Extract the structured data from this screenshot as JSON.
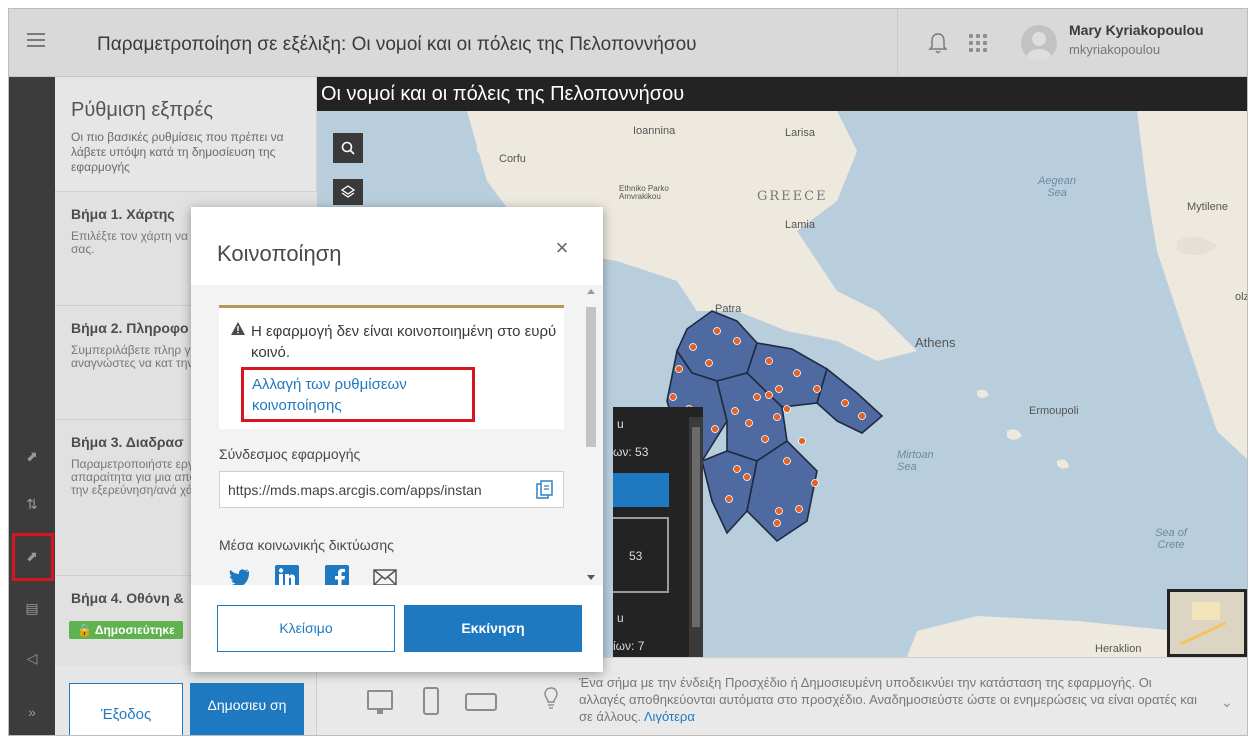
{
  "header": {
    "title": "Παραμετροποίηση σε εξέλιξη: Οι νομοί και οι πόλεις της Πελοποννήσου",
    "user_name": "Mary Kyriakopoulou",
    "user_login": "mkyriakopoulou"
  },
  "settings": {
    "title": "Ρύθμιση εξπρές",
    "description": "Οι πιο βασικές ρυθμίσεις που πρέπει να λάβετε υπόψη κατά τη δημοσίευση της εφαρμογής",
    "steps": [
      {
        "title": "Βήμα 1. Χάρτης",
        "desc": "Επιλέξτε τον χάρτη να εμφανιστεί στην σας."
      },
      {
        "title": "Βήμα 2. Πληροφο",
        "desc": "Συμπεριλάβετε πληρ για να βοηθήσετε τ αναγνώστες να κατ την εφαρμογή σας."
      },
      {
        "title": "Βήμα 3. Διαδρασ",
        "desc": "Παραμετροποιήστε εργαλεία που είναι απαραίτητα για μια αποτελεσματική εμπ την εξερεύνηση/ανά χάρτη σας."
      },
      {
        "title": "Βήμα 4. Οθόνη &",
        "desc": ""
      }
    ],
    "published_badge": "Δημοσιεύτηκε",
    "exit_label": "Έξοδος",
    "publish_label": "Δημοσιευ ση"
  },
  "map": {
    "title": "Οι νομοί και οι πόλεις της Πελοποννήσου",
    "labels": {
      "corfu": "Corfu",
      "ioannina": "Ioannina",
      "larisa": "Larisa",
      "aegean": "Aegean Sea",
      "greece": "GREECE",
      "mytilene": "Mytilene",
      "ethniko": "Ethniko Parko Amvrakikou",
      "lamia": "Lamia",
      "patra": "Patra",
      "athens": "Athens",
      "ermoupoli": "Ermoupoli",
      "mirtoan": "Mirtoan Sea",
      "sea_of_crete": "Sea of Crete",
      "heraklion": "Heraklion",
      "izmir_partial": "olz"
    },
    "legend": {
      "count1_label": "ων: 53",
      "count1_value": "53",
      "letter_top": "u",
      "letter_mid": "u",
      "count2_label": "ίων: 7"
    }
  },
  "bottom_bar": {
    "tip": "Ένα σήμα με την ένδειξη Προσχέδιο ή Δημοσιευμένη υποδεικνύει την κατάσταση της εφαρμογής. Οι αλλαγές αποθηκεύονται αυτόματα στο προσχέδιο. Αναδημοσιεύστε ώστε οι ενημερώσεις να είναι ορατές και σε άλλους.",
    "tip_link": "Λιγότερα"
  },
  "share_modal": {
    "title": "Κοινοποίηση",
    "warning": "Η εφαρμογή δεν είναι κοινοποιημένη στο ευρύ κοινό.",
    "change_link": "Αλλαγή των ρυθμίσεων κοινοποίησης",
    "link_label": "Σύνδεσμος εφαρμογής",
    "url": "https://mds.maps.arcgis.com/apps/instan",
    "social_label": "Μέσα κοινωνικής δικτύωσης",
    "close_label": "Κλείσιμο",
    "start_label": "Εκκίνηση"
  },
  "colors": {
    "accent": "#1f79c1",
    "highlight_red": "#d5151f",
    "map_water": "#b9cedd",
    "region_fill": "#4f69a1",
    "city_dot": "#e2622a"
  }
}
